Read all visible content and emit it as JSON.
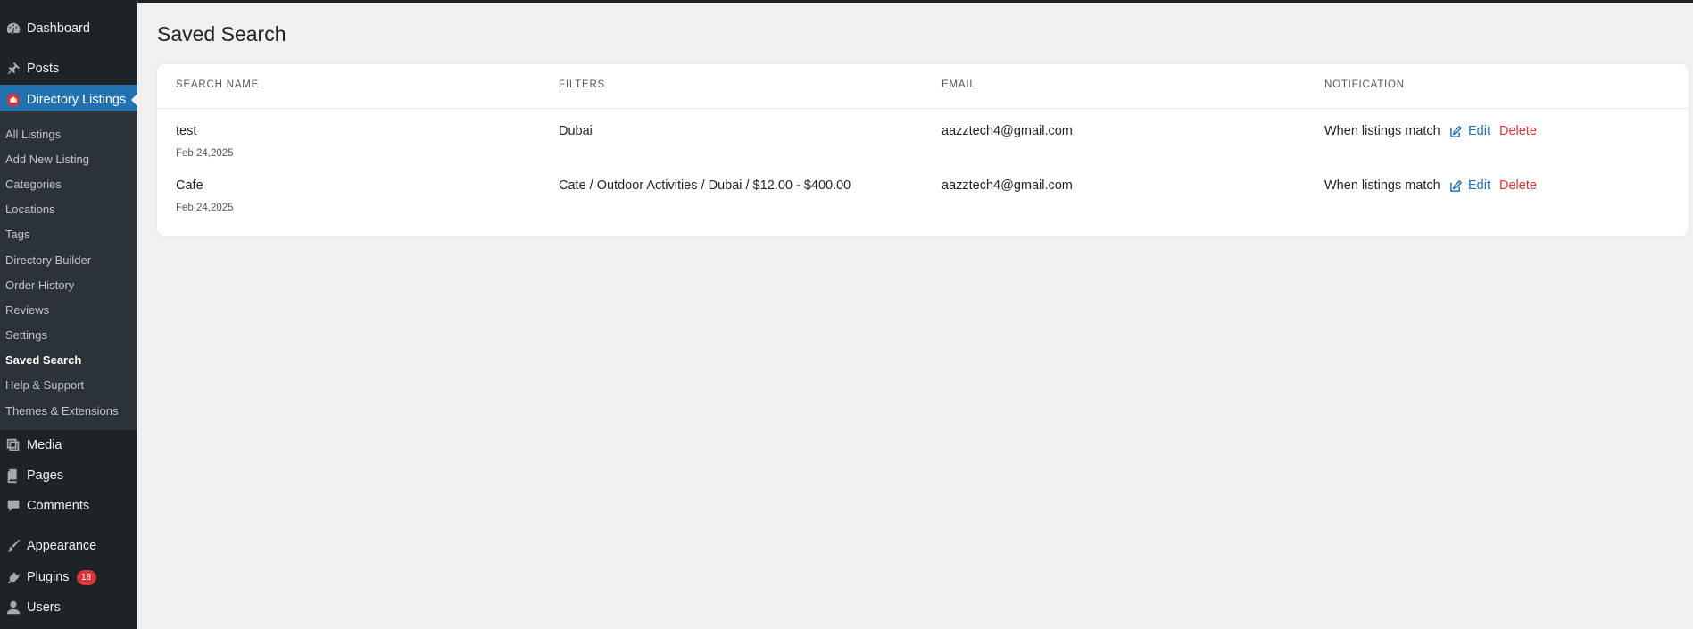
{
  "sidebar": {
    "menu": [
      {
        "id": "dashboard",
        "label": "Dashboard",
        "icon": "dashboard-icon"
      },
      {
        "id": "posts",
        "label": "Posts",
        "icon": "pin-icon"
      },
      {
        "id": "directory",
        "label": "Directory Listings",
        "icon": "directory-icon",
        "active": true
      },
      {
        "id": "media",
        "label": "Media",
        "icon": "media-icon"
      },
      {
        "id": "pages",
        "label": "Pages",
        "icon": "pages-icon"
      },
      {
        "id": "comments",
        "label": "Comments",
        "icon": "comment-icon"
      },
      {
        "id": "appearance",
        "label": "Appearance",
        "icon": "brush-icon"
      },
      {
        "id": "plugins",
        "label": "Plugins",
        "icon": "plugin-icon",
        "badge": "18"
      },
      {
        "id": "users",
        "label": "Users",
        "icon": "user-icon"
      }
    ],
    "submenu": [
      "All Listings",
      "Add New Listing",
      "Categories",
      "Locations",
      "Tags",
      "Directory Builder",
      "Order History",
      "Reviews",
      "Settings",
      "Saved Search",
      "Help & Support",
      "Themes & Extensions"
    ],
    "current_submenu": "Saved Search",
    "colors": {
      "bg": "#1d2327",
      "active": "#2271b1",
      "badge": "#d63638"
    }
  },
  "page": {
    "title": "Saved Search"
  },
  "table": {
    "columns": [
      "SEARCH NAME",
      "FILTERS",
      "EMAIL",
      "NOTIFICATION"
    ],
    "rows": [
      {
        "name": "test",
        "date": "Feb 24,2025",
        "filters": "Dubai",
        "email": "aazztech4@gmail.com",
        "notification": "When listings match",
        "edit_label": "Edit",
        "delete_label": "Delete"
      },
      {
        "name": "Cafe",
        "date": "Feb 24,2025",
        "filters": "Cate / Outdoor Activities / Dubai / $12.00 - $400.00",
        "email": "aazztech4@gmail.com",
        "notification": "When listings match",
        "edit_label": "Edit",
        "delete_label": "Delete"
      }
    ]
  }
}
